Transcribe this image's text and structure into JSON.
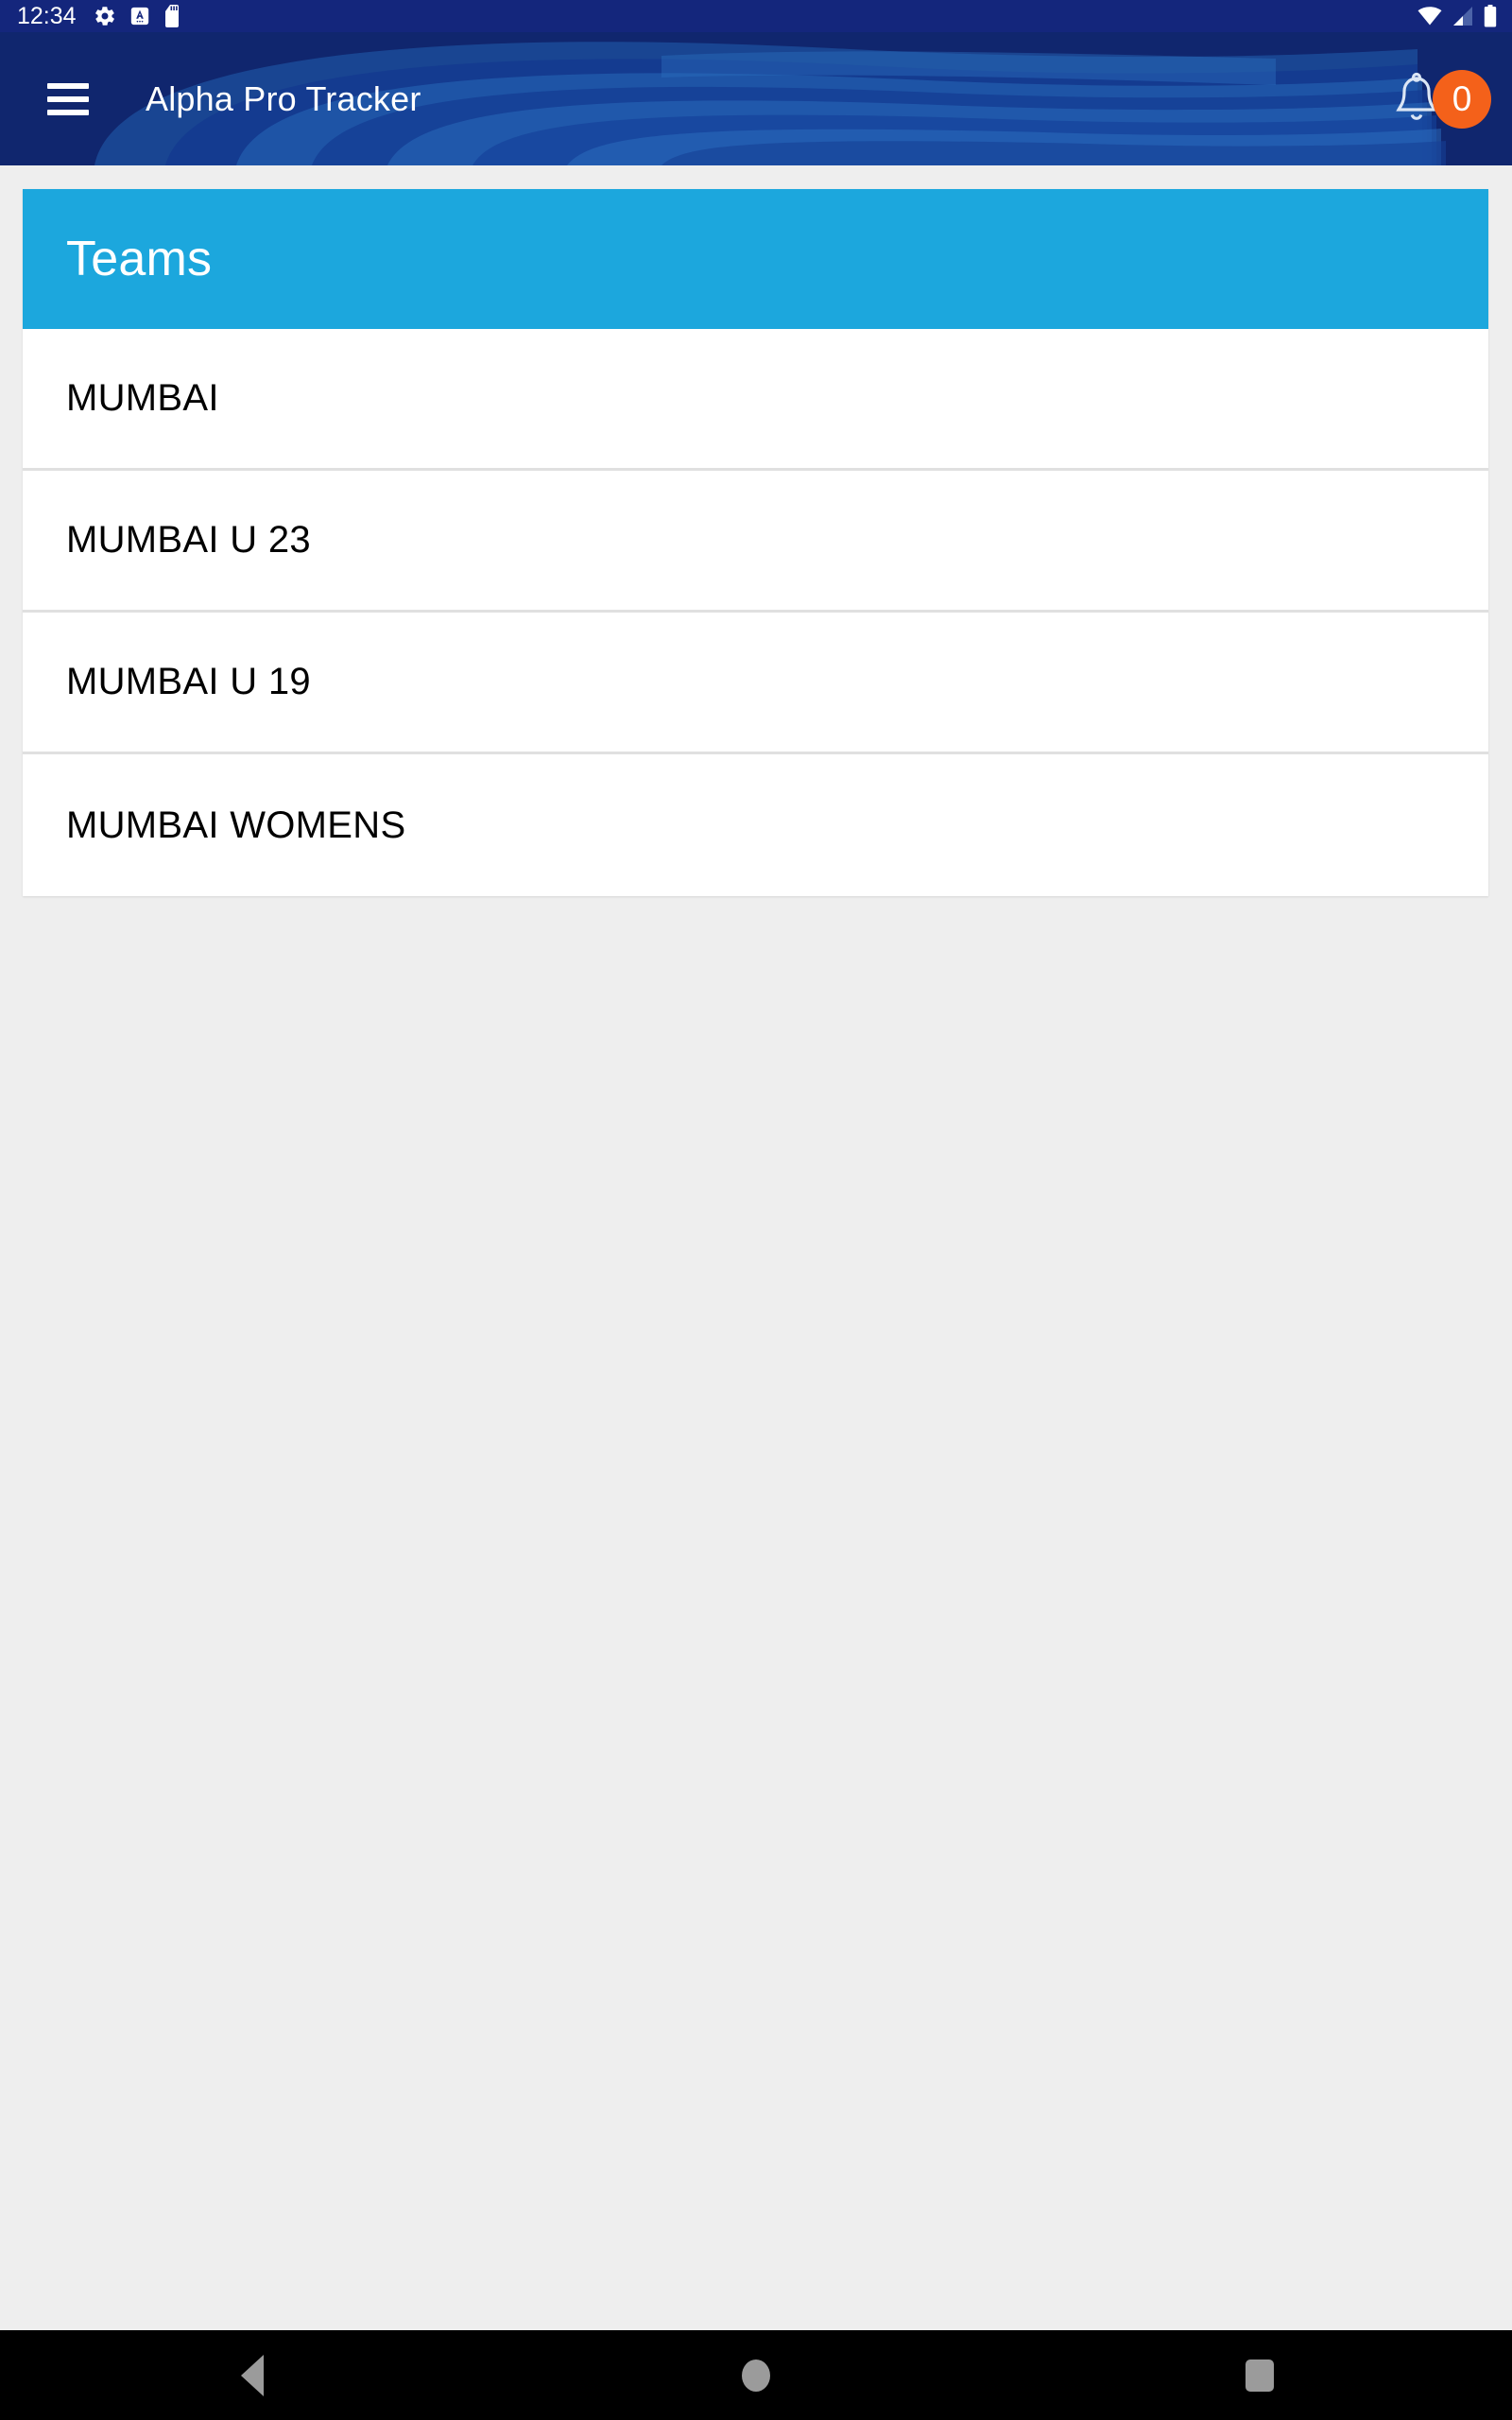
{
  "status_bar": {
    "time": "12:34",
    "left_icons": [
      "gear-icon",
      "android-a-icon",
      "sd-card-icon"
    ],
    "right_icons": [
      "wifi-icon",
      "cellular-signal-icon",
      "battery-icon"
    ],
    "background_color": "#14267c"
  },
  "app_bar": {
    "menu_icon": "hamburger-menu-icon",
    "title": "Alpha Pro Tracker",
    "notification_icon": "bell-icon",
    "notification_count": "0",
    "background_color": "#10266e",
    "badge_color": "#f4611a"
  },
  "card": {
    "header": {
      "title": "Teams",
      "background_color": "#1ca7dd"
    },
    "teams": [
      {
        "name": "MUMBAI"
      },
      {
        "name": "MUMBAI U 23"
      },
      {
        "name": "MUMBAI U 19"
      },
      {
        "name": "MUMBAI WOMENS"
      }
    ]
  },
  "nav_bar": {
    "back_label": "back-button",
    "home_label": "home-button",
    "recents_label": "recents-button",
    "background_color": "#000000"
  }
}
